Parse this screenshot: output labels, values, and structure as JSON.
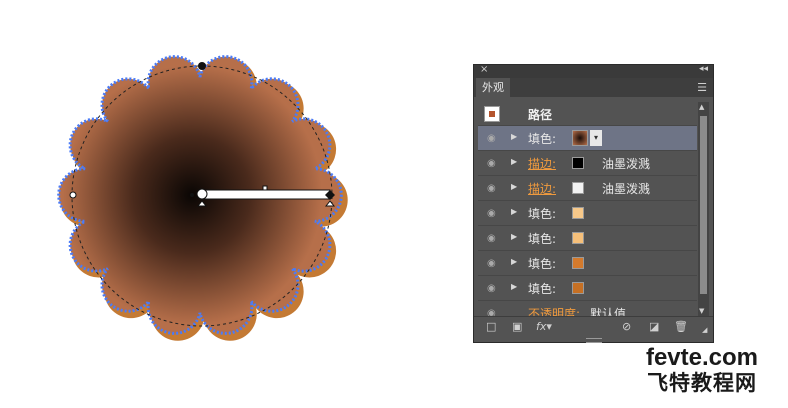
{
  "panel": {
    "close": "×",
    "collapse": "◂◂",
    "tab": "外观",
    "object_title": "路径",
    "rows": [
      {
        "label": "填色:",
        "label_style": "normal",
        "swatch": "#7a3a20",
        "desc": "",
        "selected": true
      },
      {
        "label": "描边:",
        "label_style": "orange",
        "swatch": "#000000",
        "desc": "油墨泼溅",
        "selected": false
      },
      {
        "label": "描边:",
        "label_style": "orange",
        "swatch": "#f2f2f2",
        "desc": "油墨泼溅",
        "selected": false
      },
      {
        "label": "填色:",
        "label_style": "normal",
        "swatch": "#f8c98a",
        "desc": "",
        "selected": false
      },
      {
        "label": "填色:",
        "label_style": "normal",
        "swatch": "#f6c07a",
        "desc": "",
        "selected": false
      },
      {
        "label": "填色:",
        "label_style": "normal",
        "swatch": "#d47a2c",
        "desc": "",
        "selected": false
      },
      {
        "label": "填色:",
        "label_style": "normal",
        "swatch": "#c67024",
        "desc": "",
        "selected": false
      }
    ],
    "opacity_label": "不透明度:",
    "opacity_value": "默认值"
  },
  "footer_icons": [
    "new-layer-icon",
    "new-fill-icon",
    "fx-icon",
    "clear-icon",
    "duplicate-icon",
    "trash-icon"
  ],
  "watermark": {
    "line1": "fevte.com",
    "line2": "飞特教程网"
  },
  "colors": {
    "fill_center": "#0a0604",
    "fill_edge": "#b66f4a",
    "back_fill": "#c47a34",
    "selection": "#4a7bf7"
  }
}
